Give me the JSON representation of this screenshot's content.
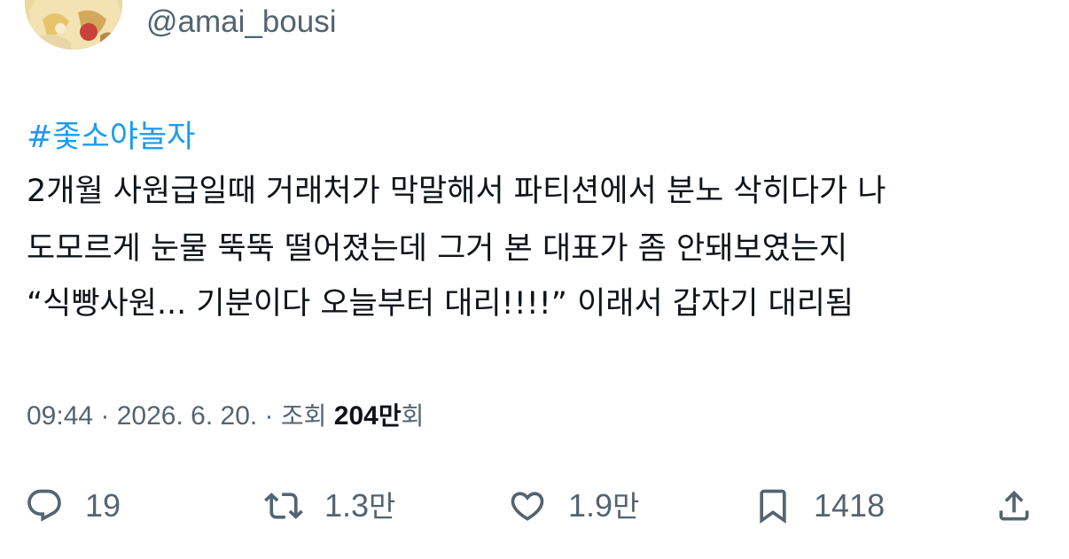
{
  "author": {
    "handle": "@amai_bousi"
  },
  "tweet": {
    "hashtag": "#좇소야놀자",
    "lines": [
      "2개월 사원급일때 거래처가 막말해서 파티션에서 분노 삭히다가 나",
      "도모르게 눈물 뚝뚝 떨어졌는데 그거 본 대표가 좀 안돼보였는지",
      "“식빵사원... 기분이다 오늘부터 대리!!!!” 이래서 갑자기 대리됨"
    ]
  },
  "meta": {
    "time": "09:44",
    "separator": " · ",
    "date": "2026. 6. 20.",
    "views_label": "조회",
    "views_number": "204",
    "views_unit": "만",
    "views_suffix": "회"
  },
  "actions": {
    "reply": {
      "icon": "reply-icon",
      "count": "19"
    },
    "retweet": {
      "icon": "retweet-icon",
      "count_num": "1.3",
      "count_unit": "만"
    },
    "like": {
      "icon": "heart-icon",
      "count_num": "1.9",
      "count_unit": "만"
    },
    "bookmark": {
      "icon": "bookmark-icon",
      "count": "1418"
    },
    "share": {
      "icon": "share-icon"
    }
  },
  "colors": {
    "link": "#1d9bf0",
    "text": "#0f1419",
    "secondary": "#536471"
  }
}
